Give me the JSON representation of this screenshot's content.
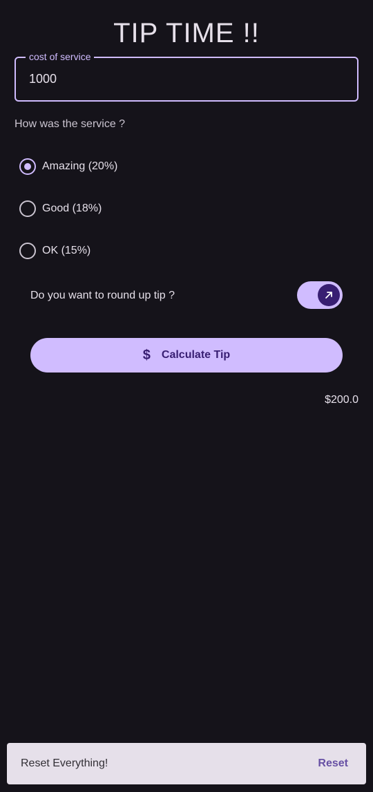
{
  "app": {
    "title": "TIP TIME !!"
  },
  "cost_field": {
    "label": "cost of service",
    "value": "1000"
  },
  "service": {
    "question": "How was the service ?",
    "options": [
      {
        "label": "Amazing (20%)",
        "selected": true
      },
      {
        "label": "Good (18%)",
        "selected": false
      },
      {
        "label": "OK (15%)",
        "selected": false
      }
    ]
  },
  "round_up": {
    "label": "Do you want to round up tip ?",
    "enabled": true,
    "thumb_icon": "arrow-up-right-icon"
  },
  "calculate_button": {
    "icon": "dollar-icon",
    "icon_glyph": "$",
    "label": "Calculate Tip"
  },
  "result": {
    "tip_amount": "$200.0"
  },
  "snackbar": {
    "message": "Reset Everything!",
    "action_label": "Reset"
  },
  "colors": {
    "background": "#15131a",
    "primary": "#d0bcff",
    "on_primary": "#381e72",
    "snackbar_bg": "#e6e0ea",
    "snackbar_action": "#6750a4"
  }
}
